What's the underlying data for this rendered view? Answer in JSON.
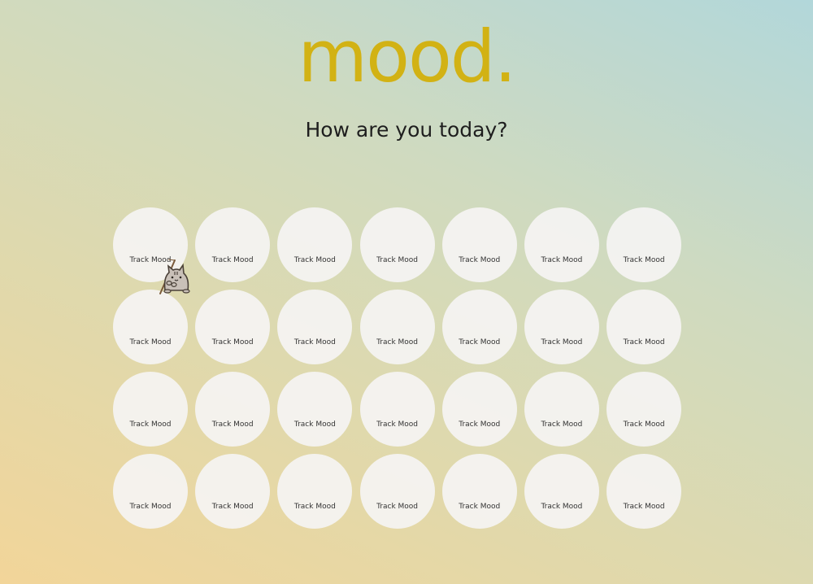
{
  "logo": "mood.",
  "subtitle": "How are you today?",
  "grid": {
    "cell_label": "Track Mood",
    "rows": 4,
    "columns": 7
  },
  "mascot": "cat-fishing-icon",
  "colors": {
    "logo": "#d2b214",
    "cell": "#f5f4f3",
    "text": "#1e1e1e"
  }
}
